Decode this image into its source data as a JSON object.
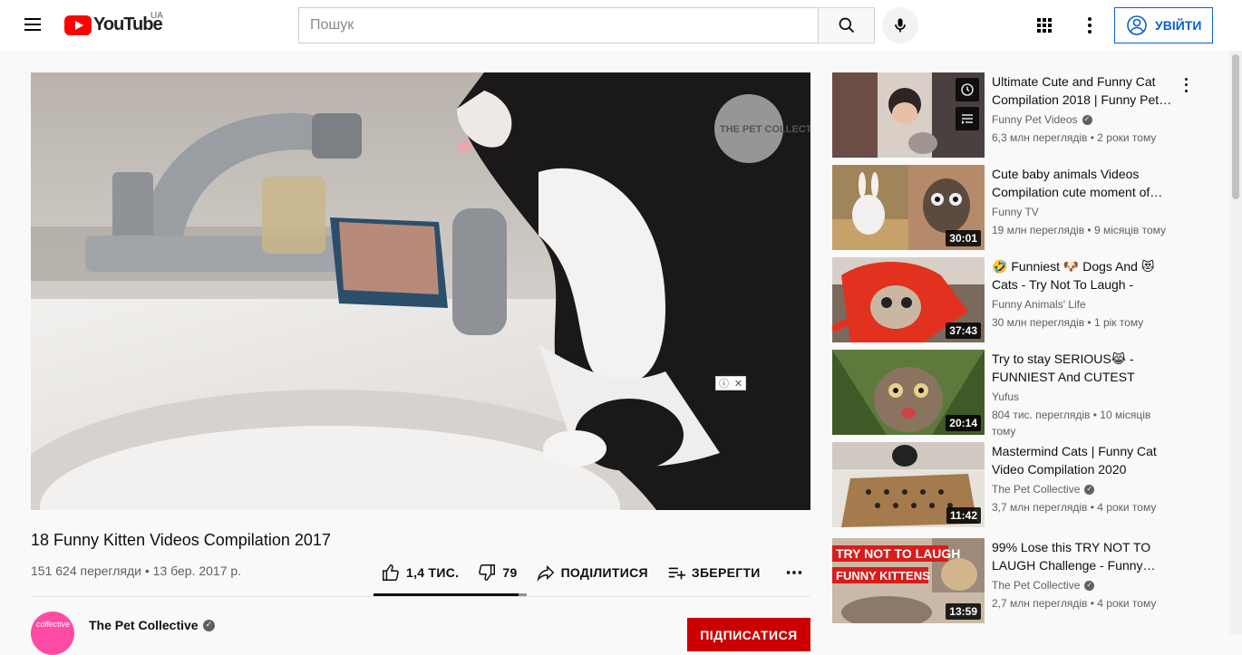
{
  "header": {
    "logo_text": "YouTube",
    "country": "UA",
    "search_placeholder": "Пошук",
    "signin_label": "УВІЙТИ"
  },
  "video": {
    "title": "18 Funny Kitten Videos Compilation 2017",
    "meta": "151 624 перегляди • 13 бер. 2017 р.",
    "likes": "1,4 ТИС.",
    "dislikes": "79",
    "share_label": "ПОДІЛИТИСЯ",
    "save_label": "ЗБЕРЕГТИ",
    "like_ratio": 0.947,
    "watermark": "THE PET COLLECTIVE"
  },
  "channel": {
    "name": "The Pet Collective",
    "avatar_text": "collective",
    "subscribe_label": "ПІДПИСАТИСЯ"
  },
  "recommendations": [
    {
      "title": "Ultimate Cute and Funny Cat Compilation 2018 | Funny Pet…",
      "channel": "Funny Pet Videos",
      "verified": true,
      "stats": "6,3 млн переглядів • 2 роки тому",
      "duration": ""
    },
    {
      "title": "Cute baby animals Videos Compilation cute moment of…",
      "channel": "Funny TV",
      "verified": false,
      "stats": "19 млн переглядів • 9 місяців тому",
      "duration": "30:01"
    },
    {
      "title": "🤣 Funniest 🐶 Dogs And 😻 Cats - Try Not To Laugh - Best…",
      "channel": "Funny Animals' Life",
      "verified": false,
      "stats": "30 млн переглядів • 1 рік тому",
      "duration": "37:43"
    },
    {
      "title": "Try to stay SERIOUS😹 - FUNNIEST And CUTEST CAT…",
      "channel": "Yufus",
      "verified": false,
      "stats": "804 тис. переглядів • 10 місяців тому",
      "duration": "20:14"
    },
    {
      "title": "Mastermind Cats | Funny Cat Video Compilation 2020",
      "channel": "The Pet Collective",
      "verified": true,
      "stats": "3,7 млн переглядів • 4 роки тому",
      "duration": "11:42"
    },
    {
      "title": "99% Lose this TRY NOT TO LAUGH Challenge - Funny…",
      "channel": "The Pet Collective",
      "verified": true,
      "stats": "2,7 млн переглядів • 4 роки тому",
      "duration": "13:59",
      "thumb_text_1": "TRY NOT TO LAUGH",
      "thumb_text_2": "FUNNY KITTENS"
    }
  ],
  "colors": {
    "brand_red": "#ff0000",
    "subscribe_red": "#cc0000",
    "link_blue": "#065fd4"
  }
}
